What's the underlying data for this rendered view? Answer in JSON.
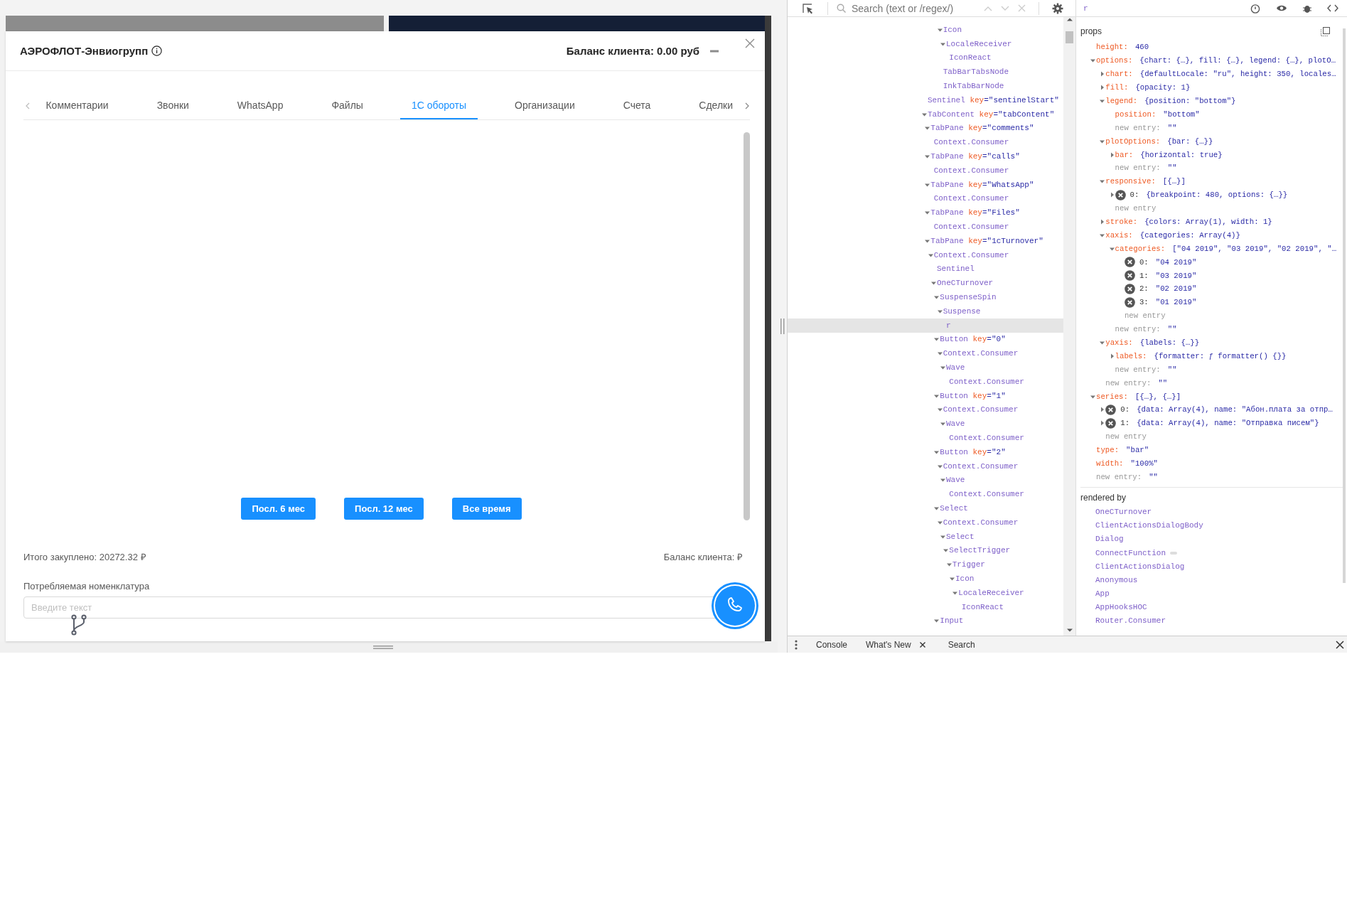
{
  "dialog": {
    "title": "АЭРОФЛОТ-Энвиогрупп",
    "balance": "Баланс клиента: 0.00 руб",
    "tabs": [
      {
        "label": "Комментарии",
        "selected": false
      },
      {
        "label": "Звонки",
        "selected": false
      },
      {
        "label": "WhatsApp",
        "selected": false
      },
      {
        "label": "Файлы",
        "selected": false
      },
      {
        "label": "1С обороты",
        "selected": true
      },
      {
        "label": "Организации",
        "selected": false
      },
      {
        "label": "Счета",
        "selected": false
      },
      {
        "label": "Сделки",
        "selected": false
      }
    ],
    "period_buttons": [
      "Посл. 6 мес",
      "Посл. 12 мес",
      "Все время"
    ],
    "total": "Итого закуплено: 20272.32 ₽",
    "client_balance": "Баланс клиента: ₽",
    "nomenclature": {
      "label": "Потребляемая номенклатура",
      "placeholder": "Введите текст"
    }
  },
  "devtools": {
    "search": {
      "placeholder": "Search (text or /regex/)"
    },
    "selected_component": "r",
    "tree": [
      {
        "children": [
          {
            "children": [
              {
                "children": [
                  {
                    "children": [
                      {
                        "children": [
                          {
                            "label": "Icon",
                            "expanded": true,
                            "selected": false,
                            "children": [
                              {
                                "label": "LocaleReceiver",
                                "expanded": true,
                                "selected": false,
                                "children": [
                                  {
                                    "label": "IconReact",
                                    "selected": false
                                  }
                                ]
                              }
                            ]
                          },
                          {
                            "label": "TabBarTabsNode",
                            "selected": false
                          },
                          {
                            "label": "InkTabBarNode",
                            "selected": false
                          }
                        ]
                      }
                    ]
                  }
                ]
              }
            ]
          }
        ]
      },
      {
        "label": "Sentinel",
        "attr": "key",
        "attr_value": "=\"sentinelStart\"",
        "selected": false
      },
      {
        "label": "TabContent",
        "attr": "key",
        "attr_value": "=\"tabContent\"",
        "expanded": true,
        "selected": false,
        "children": [
          {
            "label": "TabPane",
            "attr": "key",
            "attr_value": "=\"comments\"",
            "expanded": true,
            "selected": false,
            "children": [
              {
                "label": "Context.Consumer",
                "selected": false
              }
            ]
          },
          {
            "label": "TabPane",
            "attr": "key",
            "attr_value": "=\"calls\"",
            "expanded": true,
            "selected": false,
            "children": [
              {
                "label": "Context.Consumer",
                "selected": false
              }
            ]
          },
          {
            "label": "TabPane",
            "attr": "key",
            "attr_value": "=\"WhatsApp\"",
            "expanded": true,
            "selected": false,
            "children": [
              {
                "label": "Context.Consumer",
                "selected": false
              }
            ]
          },
          {
            "label": "TabPane",
            "attr": "key",
            "attr_value": "=\"Files\"",
            "expanded": true,
            "selected": false,
            "children": [
              {
                "label": "Context.Consumer",
                "selected": false
              }
            ]
          },
          {
            "label": "TabPane",
            "attr": "key",
            "attr_value": "=\"1cTurnover\"",
            "expanded": true,
            "selected": false,
            "children": [
              {
                "label": "Context.Consumer",
                "expanded": true,
                "selected": false,
                "children": [
                  {
                    "label": "Sentinel",
                    "selected": false
                  },
                  {
                    "label": "OneCTurnover",
                    "expanded": true,
                    "selected": false,
                    "children": [
                      {
                        "label": "SuspenseSpin",
                        "expanded": true,
                        "selected": false,
                        "children": [
                          {
                            "label": "Suspense",
                            "expanded": true,
                            "selected": false,
                            "children": [
                              {
                                "label": "r",
                                "selected": true
                              }
                            ]
                          }
                        ]
                      },
                      {
                        "label": "Button",
                        "attr": "key",
                        "attr_value": "=\"0\"",
                        "expanded": true,
                        "selected": false,
                        "children": [
                          {
                            "label": "Context.Consumer",
                            "expanded": true,
                            "selected": false,
                            "children": [
                              {
                                "label": "Wave",
                                "expanded": true,
                                "selected": false,
                                "children": [
                                  {
                                    "label": "Context.Consumer",
                                    "selected": false
                                  }
                                ]
                              }
                            ]
                          }
                        ]
                      },
                      {
                        "label": "Button",
                        "attr": "key",
                        "attr_value": "=\"1\"",
                        "expanded": true,
                        "selected": false,
                        "children": [
                          {
                            "label": "Context.Consumer",
                            "expanded": true,
                            "selected": false,
                            "children": [
                              {
                                "label": "Wave",
                                "expanded": true,
                                "selected": false,
                                "children": [
                                  {
                                    "label": "Context.Consumer",
                                    "selected": false
                                  }
                                ]
                              }
                            ]
                          }
                        ]
                      },
                      {
                        "label": "Button",
                        "attr": "key",
                        "attr_value": "=\"2\"",
                        "expanded": true,
                        "selected": false,
                        "children": [
                          {
                            "label": "Context.Consumer",
                            "expanded": true,
                            "selected": false,
                            "children": [
                              {
                                "label": "Wave",
                                "expanded": true,
                                "selected": false,
                                "children": [
                                  {
                                    "label": "Context.Consumer",
                                    "selected": false
                                  }
                                ]
                              }
                            ]
                          }
                        ]
                      },
                      {
                        "label": "Select",
                        "expanded": true,
                        "selected": false,
                        "children": [
                          {
                            "label": "Context.Consumer",
                            "expanded": true,
                            "selected": false,
                            "children": [
                              {
                                "label": "Select",
                                "expanded": true,
                                "selected": false,
                                "children": [
                                  {
                                    "label": "SelectTrigger",
                                    "expanded": true,
                                    "selected": false,
                                    "children": [
                                      {
                                        "label": "Trigger",
                                        "expanded": true,
                                        "selected": false,
                                        "children": [
                                          {
                                            "label": "Icon",
                                            "expanded": true,
                                            "selected": false,
                                            "children": [
                                              {
                                                "label": "LocaleReceiver",
                                                "expanded": true,
                                                "selected": false,
                                                "children": [
                                                  {
                                                    "label": "IconReact",
                                                    "selected": false
                                                  }
                                                ]
                                              }
                                            ]
                                          }
                                        ]
                                      }
                                    ]
                                  }
                                ]
                              }
                            ]
                          }
                        ]
                      },
                      {
                        "label": "Input",
                        "expanded": true,
                        "selected": false
                      }
                    ]
                  }
                ]
              }
            ]
          }
        ]
      }
    ],
    "props": {
      "title": "props",
      "entries": [
        {
          "kind": "prop",
          "key": "height:",
          "value": "460"
        },
        {
          "kind": "prop",
          "key": "options:",
          "value": "{chart: {…}, fill: {…}, legend: {…}, plotO…",
          "expanded": true,
          "children": [
            {
              "kind": "prop",
              "key": "chart:",
              "value": "{defaultLocale: \"ru\", height: 350, locales…",
              "expanded": false
            },
            {
              "kind": "prop",
              "key": "fill:",
              "value": "{opacity: 1}",
              "expanded": false
            },
            {
              "kind": "prop",
              "key": "legend:",
              "value": "{position: \"bottom\"}",
              "expanded": true,
              "children": [
                {
                  "kind": "prop",
                  "key": "position:",
                  "value": "\"bottom\""
                },
                {
                  "kind": "new",
                  "key": "new entry:",
                  "value": "\"\""
                }
              ]
            },
            {
              "kind": "prop",
              "key": "plotOptions:",
              "value": "{bar: {…}}",
              "expanded": true,
              "children": [
                {
                  "kind": "prop",
                  "key": "bar:",
                  "value": "{horizontal: true}",
                  "expanded": false
                },
                {
                  "kind": "new",
                  "key": "new entry:",
                  "value": "\"\""
                }
              ]
            },
            {
              "kind": "prop",
              "key": "responsive:",
              "value": "[{…}]",
              "expanded": true,
              "children": [
                {
                  "kind": "index",
                  "key": "0:",
                  "value": "{breakpoint: 480, options: {…}}",
                  "expanded": false
                },
                {
                  "kind": "new",
                  "key": "new entry"
                }
              ]
            },
            {
              "kind": "prop",
              "key": "stroke:",
              "value": "{colors: Array(1), width: 1}",
              "expanded": false
            },
            {
              "kind": "prop",
              "key": "xaxis:",
              "value": "{categories: Array(4)}",
              "expanded": true,
              "children": [
                {
                  "kind": "prop",
                  "key": "categories:",
                  "value": "[\"04 2019\", \"03 2019\", \"02 2019\", \"…",
                  "expanded": true,
                  "children": [
                    {
                      "kind": "index",
                      "key": "0:",
                      "value": "\"04 2019\""
                    },
                    {
                      "kind": "index",
                      "key": "1:",
                      "value": "\"03 2019\""
                    },
                    {
                      "kind": "index",
                      "key": "2:",
                      "value": "\"02 2019\""
                    },
                    {
                      "kind": "index",
                      "key": "3:",
                      "value": "\"01 2019\""
                    },
                    {
                      "kind": "new",
                      "key": "new entry"
                    }
                  ]
                },
                {
                  "kind": "new",
                  "key": "new entry:",
                  "value": "\"\""
                }
              ]
            },
            {
              "kind": "prop",
              "key": "yaxis:",
              "value": "{labels: {…}}",
              "expanded": true,
              "children": [
                {
                  "kind": "prop",
                  "key": "labels:",
                  "value": "{formatter: ƒ formatter() {}}",
                  "expanded": false
                },
                {
                  "kind": "new",
                  "key": "new entry:",
                  "value": "\"\""
                }
              ]
            },
            {
              "kind": "new",
              "key": "new entry:",
              "value": "\"\""
            }
          ]
        },
        {
          "kind": "prop",
          "key": "series:",
          "value": "[{…}, {…}]",
          "expanded": true,
          "children": [
            {
              "kind": "index",
              "key": "0:",
              "value": "{data: Array(4), name: \"Абон.плата за отпр…",
              "expanded": false
            },
            {
              "kind": "index",
              "key": "1:",
              "value": "{data: Array(4), name: \"Отправка писем\"}",
              "expanded": false
            },
            {
              "kind": "new",
              "key": "new entry"
            }
          ]
        },
        {
          "kind": "prop",
          "key": "type:",
          "value": "\"bar\""
        },
        {
          "kind": "prop",
          "key": "width:",
          "value": "\"100%\""
        },
        {
          "kind": "new",
          "key": "new entry:",
          "value": "\"\""
        }
      ]
    },
    "rendered_by": {
      "title": "rendered by",
      "items": [
        {
          "label": "OneCTurnover",
          "badge": false
        },
        {
          "label": "ClientActionsDialogBody",
          "badge": false
        },
        {
          "label": "Dialog",
          "badge": false
        },
        {
          "label": "ConnectFunction",
          "badge": true
        },
        {
          "label": "ClientActionsDialog",
          "badge": false
        },
        {
          "label": "Anonymous",
          "badge": false
        },
        {
          "label": "App",
          "badge": false
        },
        {
          "label": "AppHooksHOC",
          "badge": false
        },
        {
          "label": "Router.Consumer",
          "badge": false
        }
      ]
    },
    "drawer_tabs": [
      {
        "label": "Console",
        "closable": false
      },
      {
        "label": "What's New",
        "closable": true
      },
      {
        "label": "Search",
        "closable": false
      }
    ]
  }
}
